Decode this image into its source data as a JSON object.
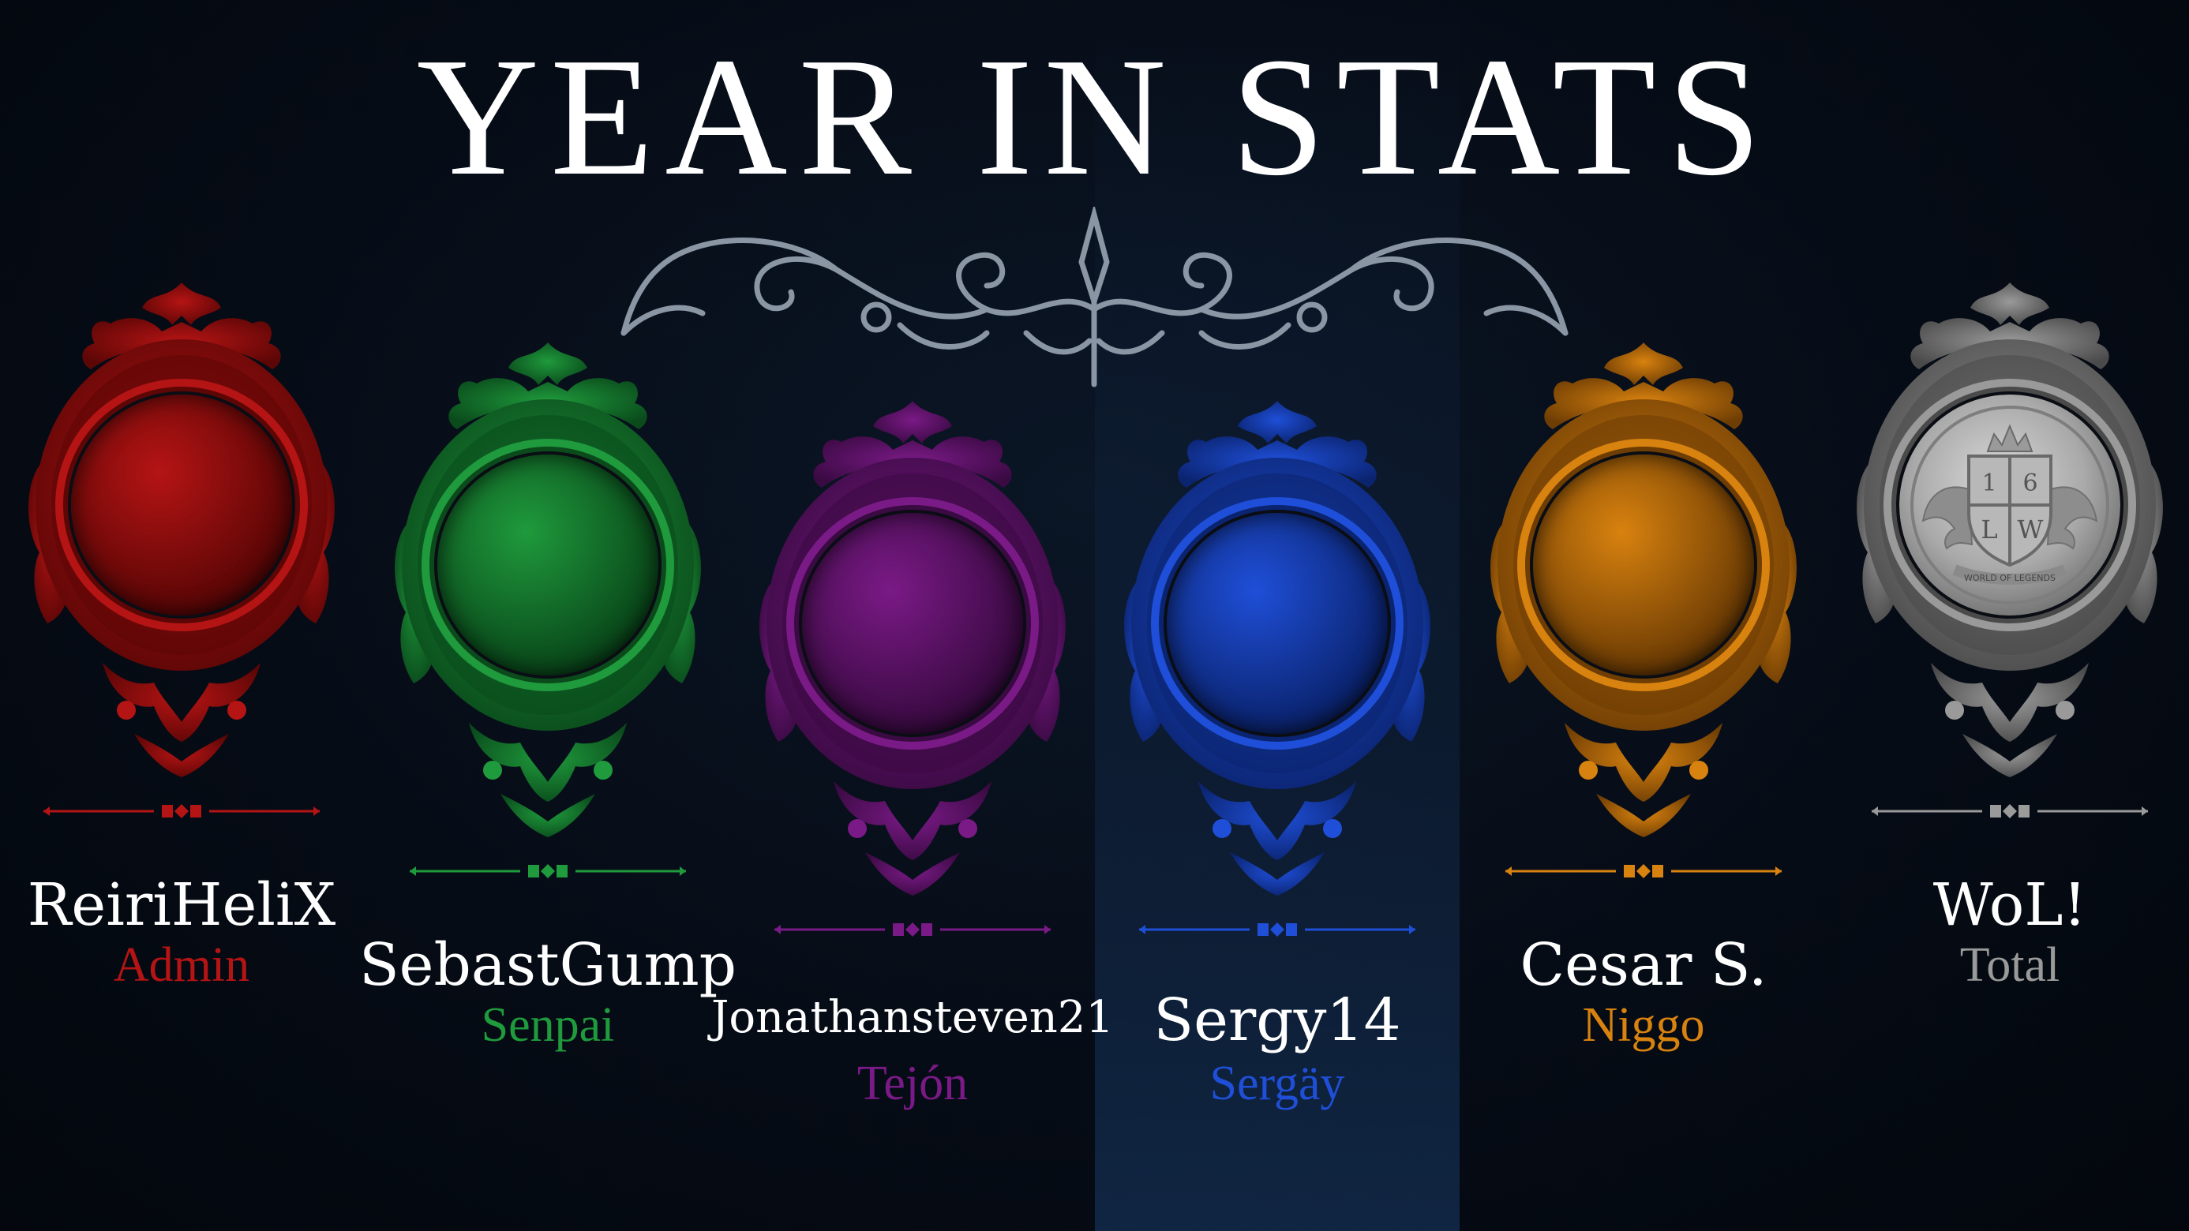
{
  "title": "YEAR IN STATS",
  "members": [
    {
      "name": "ReiriHeliX",
      "role": "Admin",
      "color": "#b51414",
      "dark": "#5c0606",
      "avatar": "anime-character-avatar"
    },
    {
      "name": "SebastGump",
      "role": "Senpai",
      "color": "#1f9a3c",
      "dark": "#0a4a1b",
      "avatar": "person-photo-avatar"
    },
    {
      "name": "Jonathansteven21",
      "role": "Tejón",
      "color": "#7a1a86",
      "dark": "#3a0a42",
      "avatar": "swimmer-photo-avatar"
    },
    {
      "name": "Sergy14",
      "role": "Sergäy",
      "color": "#1f4fd8",
      "dark": "#0b2470",
      "avatar": "person-photo-avatar"
    },
    {
      "name": "Cesar S.",
      "role": "Niggo",
      "color": "#d8820f",
      "dark": "#6e3d04",
      "avatar": "person-photo-avatar"
    },
    {
      "name": "WoL!",
      "role": "Total",
      "color": "#9a9a9a",
      "dark": "#4a4a4a",
      "avatar": "world-of-legends-emblem"
    }
  ],
  "emblem": {
    "top_left": "1",
    "top_right": "6",
    "bottom_left": "L",
    "bottom_right": "W",
    "banner": "WORLD OF LEGENDS"
  }
}
